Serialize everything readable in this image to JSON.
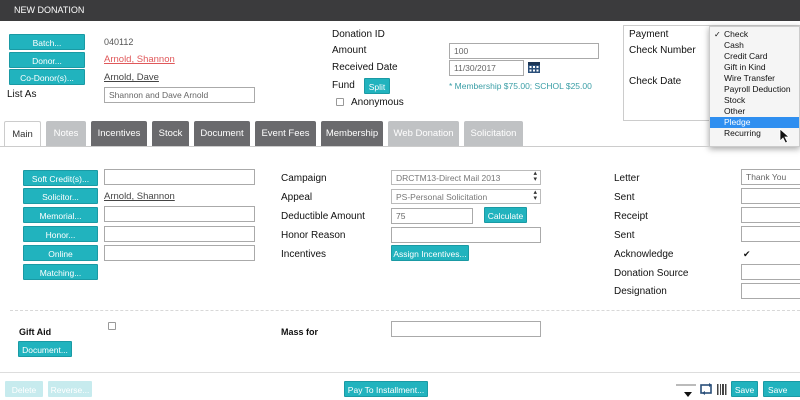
{
  "window": {
    "title": "NEW DONATION"
  },
  "donor": {
    "batch_btn": "Batch...",
    "batch_value": "040112",
    "donor_btn": "Donor...",
    "donor_link": "Arnold, Shannon",
    "codonor_btn": "Co-Donor(s)...",
    "codonor_link": "Arnold, Dave",
    "list_as_label": "List As",
    "list_as_value": "Shannon and Dave Arnold"
  },
  "donation": {
    "id_label": "Donation ID",
    "amount_label": "Amount",
    "amount_value": "100",
    "received_label": "Received Date",
    "received_value": "11/30/2017",
    "fund_label": "Fund",
    "split_btn": "Split",
    "fund_note": "* Membership $75.00; SCHOL $25.00",
    "anonymous_label": "Anonymous"
  },
  "payment": {
    "payment_label": "Payment",
    "check_number_label": "Check Number",
    "check_date_label": "Check Date",
    "options": [
      "Check",
      "Cash",
      "Credit Card",
      "Gift in Kind",
      "Wire Transfer",
      "Payroll Deduction",
      "Stock",
      "Other",
      "Pledge",
      "Recurring"
    ],
    "selected": "Check",
    "highlighted": "Pledge"
  },
  "tabs": [
    "Main",
    "Notes",
    "Incentives",
    "Stock",
    "Document",
    "Event Fees",
    "Membership",
    "Web Donation",
    "Solicitation"
  ],
  "main": {
    "soft_credit_btn": "Soft Credit(s)...",
    "solicitor_btn": "Solicitor...",
    "solicitor_link": "Arnold, Shannon",
    "memorial_btn": "Memorial...",
    "honor_btn": "Honor...",
    "online_dedication_btn": "Online Dedication...",
    "matching_btn": "Matching...",
    "campaign_label": "Campaign",
    "campaign_value": "DRCTM13-Direct Mail 2013",
    "appeal_label": "Appeal",
    "appeal_value": "PS-Personal Solicitation",
    "deductible_label": "Deductible Amount",
    "deductible_value": "75",
    "calculate_btn": "Calculate",
    "honor_reason_label": "Honor Reason",
    "incentives_label": "Incentives",
    "assign_incentives_btn": "Assign Incentives...",
    "letter_label": "Letter",
    "letter_value": "Thank You",
    "sent_label": "Sent",
    "receipt_label": "Receipt",
    "sent2_label": "Sent",
    "acknowledge_label": "Acknowledge",
    "donation_source_label": "Donation Source",
    "designation_label": "Designation",
    "gift_aid_label": "Gift Aid",
    "document_btn": "Document...",
    "mass_for_label": "Mass for"
  },
  "footer": {
    "delete_btn": "Delete",
    "reverse_btn": "Reverse...",
    "pay_installment_btn": "Pay To Installment...",
    "save_btn": "Save",
    "save_and_btn": "Save and"
  },
  "colors": {
    "accent": "#21b3be",
    "titlebar": "#3b3b3d",
    "highlight": "#2f8ff0"
  }
}
